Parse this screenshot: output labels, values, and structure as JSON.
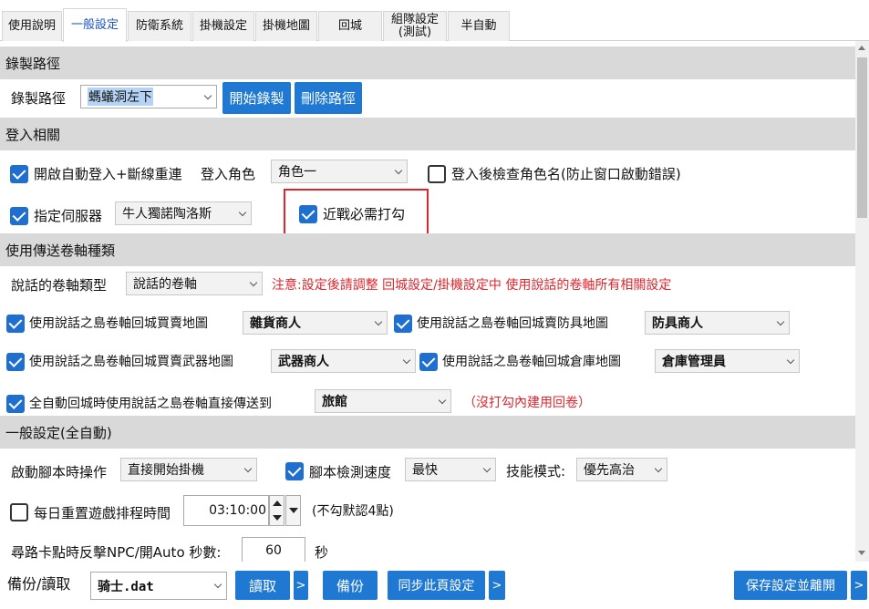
{
  "tabs": [
    {
      "label": "使用說明"
    },
    {
      "label": "一般設定"
    },
    {
      "label": "防衛系統"
    },
    {
      "label": "掛機設定"
    },
    {
      "label": "掛機地圖"
    },
    {
      "label": "回城"
    },
    {
      "label": "組隊設定\n(測試)"
    },
    {
      "label": "半自動"
    }
  ],
  "record": {
    "section_title": "錄製路徑",
    "path_label": "錄製路徑",
    "path_value": "螞蟻洞左下",
    "start_button": "開始錄製",
    "delete_button": "刪除路徑"
  },
  "login": {
    "section_title": "登入相關",
    "auto_login_label": "開啟自動登入+斷線重連",
    "auto_login_checked": true,
    "role_label": "登入角色",
    "role_value": "角色一",
    "check_name_label": "登入後檢查角色名(防止窗口啟動錯誤)",
    "check_name_checked": false,
    "server_label": "指定伺服器",
    "server_checked": true,
    "server_value": "牛人獨諾陶洛斯",
    "melee_label": "近戰必需打勾",
    "melee_checked": true
  },
  "scroll": {
    "section_title": "使用傳送卷軸種類",
    "type_label": "說話的卷軸類型",
    "type_value": "說話的卷軸",
    "notice": "注意:設定後請調整 回城設定/掛機設定中 使用說話的卷軸所有相關設定",
    "grocery_label": "使用說話之島卷軸回城買賣地圖",
    "grocery_value": "雜貨商人",
    "armor_label": "使用說話之島卷軸回城賣防具地圖",
    "armor_value": "防具商人",
    "weapon_label": "使用說話之島卷軸回城買賣武器地圖",
    "weapon_value": "武器商人",
    "warehouse_label": "使用說話之島卷軸回城倉庫地圖",
    "warehouse_value": "倉庫管理員",
    "direct_label": "全自動回城時使用說話之島卷軸直接傳送到",
    "direct_value": "旅館",
    "direct_note": "（沒打勾內建用回卷）"
  },
  "general": {
    "section_title": "一般設定(全自動)",
    "startup_label": "啟動腳本時操作",
    "startup_value": "直接開始掛機",
    "speed_label": "腳本檢測速度",
    "speed_checked": true,
    "speed_value": "最快",
    "skill_label": "技能模式:",
    "skill_value": "優先高治",
    "reset_label": "每日重置遊戲排程時間",
    "reset_checked": false,
    "reset_time": "03:10:00",
    "reset_note": "(不勾默認4點)",
    "stuck_label": "尋路卡點時反擊NPC/開Auto 秒數:",
    "stuck_value": "60",
    "stuck_unit": "秒"
  },
  "bottom": {
    "backup_label": "備份/讀取",
    "file_value": "骑士.dat",
    "read_button": "讀取",
    "more_button": ">",
    "backup_button": "備份",
    "sync_button": "同步此頁設定",
    "save_button": "保存設定並離開"
  },
  "colors": {
    "accent": "#1f78d1",
    "section_bg": "#d9d9d9",
    "warning": "#e0262d"
  }
}
